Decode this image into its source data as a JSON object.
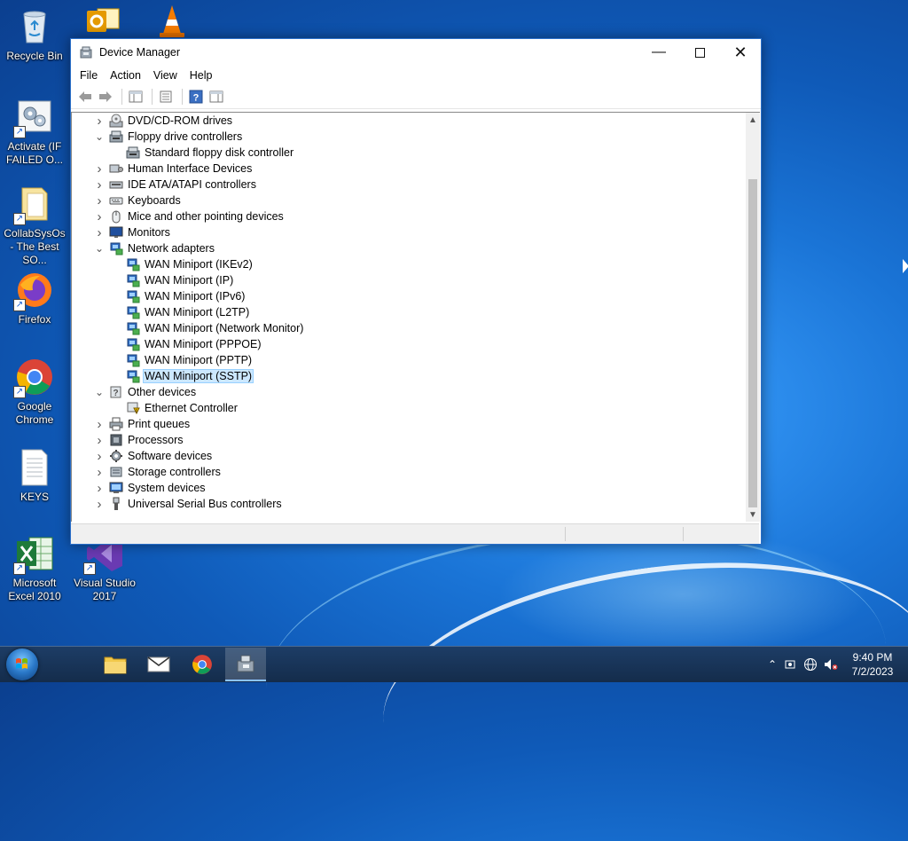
{
  "desktop": {
    "icons": [
      {
        "label": "Recycle Bin"
      },
      {
        "label": "Activate (IF FAILED O..."
      },
      {
        "label": "CollabSysOs - The Best SO..."
      },
      {
        "label": "Firefox"
      },
      {
        "label": "Google Chrome"
      },
      {
        "label": "KEYS"
      },
      {
        "label": "Microsoft Excel 2010"
      },
      {
        "label": "Visual Studio 2017"
      }
    ]
  },
  "window": {
    "title": "Device Manager",
    "menu": [
      "File",
      "Action",
      "View",
      "Help"
    ],
    "tree": [
      {
        "label": "DVD/CD-ROM drives",
        "level": 0,
        "expanded": false
      },
      {
        "label": "Floppy drive controllers",
        "level": 0,
        "expanded": true
      },
      {
        "label": "Standard floppy disk controller",
        "level": 1
      },
      {
        "label": "Human Interface Devices",
        "level": 0,
        "expanded": false
      },
      {
        "label": "IDE ATA/ATAPI controllers",
        "level": 0,
        "expanded": false
      },
      {
        "label": "Keyboards",
        "level": 0,
        "expanded": false
      },
      {
        "label": "Mice and other pointing devices",
        "level": 0,
        "expanded": false
      },
      {
        "label": "Monitors",
        "level": 0,
        "expanded": false
      },
      {
        "label": "Network adapters",
        "level": 0,
        "expanded": true
      },
      {
        "label": "WAN Miniport (IKEv2)",
        "level": 1
      },
      {
        "label": "WAN Miniport (IP)",
        "level": 1
      },
      {
        "label": "WAN Miniport (IPv6)",
        "level": 1
      },
      {
        "label": "WAN Miniport (L2TP)",
        "level": 1
      },
      {
        "label": "WAN Miniport (Network Monitor)",
        "level": 1
      },
      {
        "label": "WAN Miniport (PPPOE)",
        "level": 1
      },
      {
        "label": "WAN Miniport (PPTP)",
        "level": 1
      },
      {
        "label": "WAN Miniport (SSTP)",
        "level": 1,
        "selected": true
      },
      {
        "label": "Other devices",
        "level": 0,
        "expanded": true
      },
      {
        "label": "Ethernet Controller",
        "level": 1,
        "warning": true
      },
      {
        "label": "Print queues",
        "level": 0,
        "expanded": false
      },
      {
        "label": "Processors",
        "level": 0,
        "expanded": false
      },
      {
        "label": "Software devices",
        "level": 0,
        "expanded": false
      },
      {
        "label": "Storage controllers",
        "level": 0,
        "expanded": false
      },
      {
        "label": "System devices",
        "level": 0,
        "expanded": false
      },
      {
        "label": "Universal Serial Bus controllers",
        "level": 0,
        "expanded": false
      }
    ]
  },
  "taskbar": {
    "time": "9:40 PM",
    "date": "7/2/2023"
  }
}
